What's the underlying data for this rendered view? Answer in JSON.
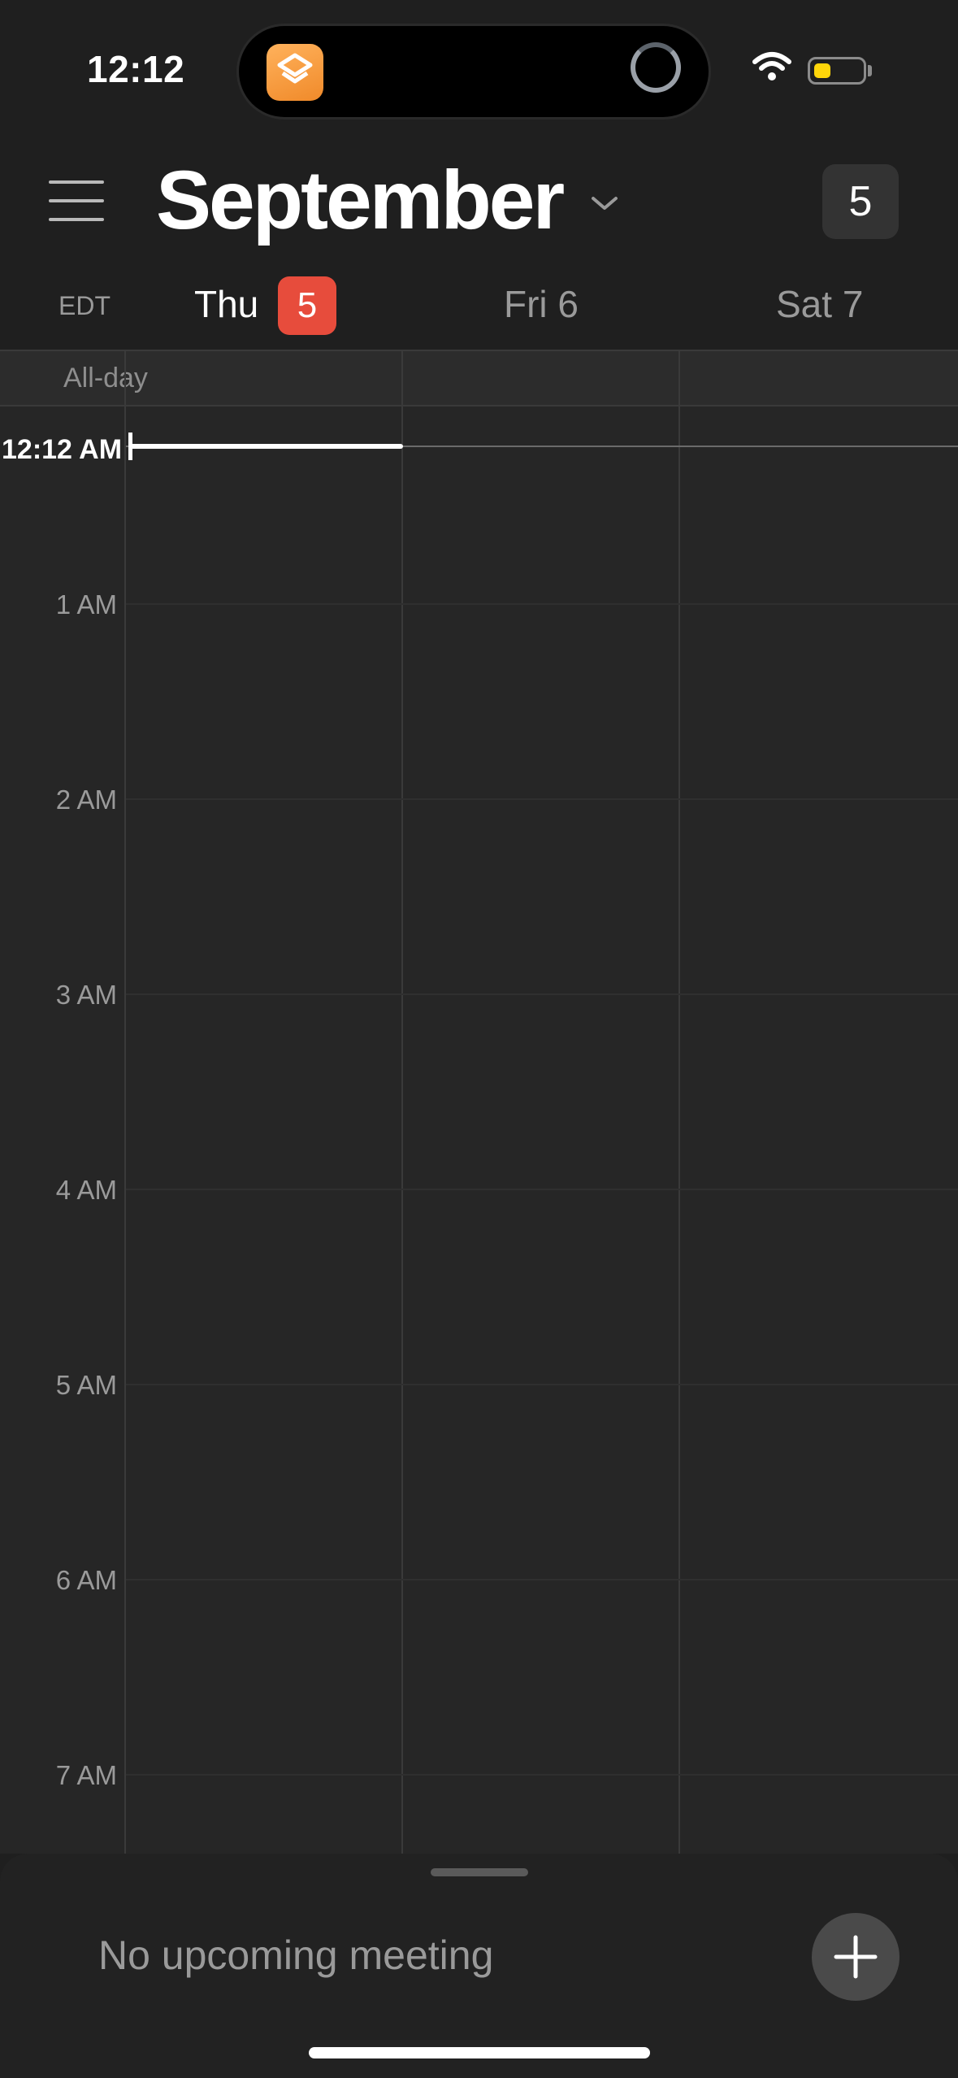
{
  "status_bar": {
    "time": "12:12"
  },
  "header": {
    "month": "September",
    "today_number": "5"
  },
  "day_header": {
    "timezone": "EDT",
    "days": [
      {
        "name": "Thu",
        "number": "5",
        "today": true
      },
      {
        "name": "Fri",
        "number": "6"
      },
      {
        "name": "Sat",
        "number": "7"
      }
    ]
  },
  "calendar": {
    "all_day_label": "All-day",
    "current_time": "12:12 AM",
    "hours": [
      "1 AM",
      "2 AM",
      "3 AM",
      "4 AM",
      "5 AM",
      "6 AM",
      "7 AM"
    ]
  },
  "bottom_sheet": {
    "message": "No upcoming meeting"
  },
  "colors": {
    "background": "#1f1f1f",
    "grid": "#262626",
    "today_badge": "#e74c3c",
    "battery": "#ffd60a"
  },
  "icons": {
    "menu": "hamburger-icon",
    "chevron": "chevron-down-icon",
    "add": "plus-icon",
    "wifi": "wifi-icon",
    "battery": "battery-icon"
  }
}
